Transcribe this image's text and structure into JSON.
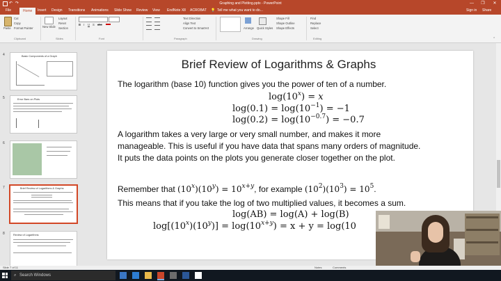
{
  "window": {
    "title": "Graphing and Plotting.pptx - PowerPoint",
    "controls": [
      "—",
      "❐",
      "✕"
    ]
  },
  "ribbon": {
    "tabs": [
      "File",
      "Home",
      "Insert",
      "Design",
      "Transitions",
      "Animations",
      "Slide Show",
      "Review",
      "View",
      "EndNote X8",
      "ACROBAT"
    ],
    "active_tab": "Home",
    "tell_me": "Tell me what you want to do...",
    "sign_in": "Sign in",
    "share": "Share",
    "clipboard": {
      "paste": "Paste",
      "cut": "Cut",
      "copy": "Copy",
      "format_painter": "Format Painter",
      "label": "Clipboard"
    },
    "slides": {
      "new_slide": "New Slide",
      "layout": "Layout",
      "reset": "Reset",
      "section": "Section",
      "label": "Slides"
    },
    "font": {
      "label": "Font"
    },
    "paragraph": {
      "text_direction": "Text Direction",
      "align_text": "Align Text",
      "convert_smartart": "Convert to SmartArt",
      "label": "Paragraph"
    },
    "drawing": {
      "arrange": "Arrange",
      "quick_styles": "Quick Styles",
      "shape_fill": "Shape Fill",
      "shape_outline": "Shape Outline",
      "shape_effects": "Shape Effects",
      "label": "Drawing"
    },
    "editing": {
      "find": "Find",
      "replace": "Replace",
      "select": "Select",
      "label": "Editing"
    }
  },
  "thumbnails": [
    {
      "num": "4",
      "title": "Basic Components of a Graph",
      "active": false
    },
    {
      "num": "5",
      "title": "Error Bars on Plots",
      "active": false
    },
    {
      "num": "6",
      "title": "",
      "active": false
    },
    {
      "num": "7",
      "title": "Brief Review of Logarithms & Graphs",
      "active": true
    },
    {
      "num": "8",
      "title": "Review of Logarithms",
      "active": false
    }
  ],
  "slide": {
    "title": "Brief Review of Logarithms & Graphs",
    "line1": "The logarithm (base 10) function gives you the power of ten of a number.",
    "eq1_left": "log(10",
    "eq1_sup": "x",
    "eq1_right": ") = ",
    "eq1_var": "x",
    "eq2": "log(0.1) = log(10",
    "eq2_sup": "−1",
    "eq2_right": ") = −1",
    "eq3": "log(0.2) = log(10",
    "eq3_sup": "−0.7",
    "eq3_right": ") = −0.7",
    "para1_line1": "A logarithm takes a very large or very small number, and makes it more",
    "para1_line2": "manageable. This is useful if you have data that spans many orders of magnitude.",
    "para1_line3": "It puts the data points on the plots you generate closer together on the plot.",
    "remember_a": "Remember that ",
    "remember_math1": "(10",
    "remember_sup1": "x",
    "remember_math2": ")(10",
    "remember_sup2": "y",
    "remember_math3": ") = 10",
    "remember_sup3": "x+y",
    "remember_b": ", for example ",
    "ex1": "(10",
    "ex_sup1": "2",
    "ex2": ")(10",
    "ex_sup2": "3",
    "ex3": ") = 10",
    "ex_sup3": "5",
    "ex4": ".",
    "line_sum": "This means that if you take the log of two multiplied values, it becomes a sum.",
    "eq4": "log(AB) = log(A) + log(B)",
    "eq5a": "log[(10",
    "eq5_sup1": "x",
    "eq5b": ")(10",
    "eq5_sup2": "y",
    "eq5c": ")] = log(10",
    "eq5_sup3": "x+y",
    "eq5d": ") = x + y = log(10"
  },
  "status": {
    "slide_of": "Slide 7 of 11",
    "notes": "Notes",
    "comments": "Comments"
  },
  "taskbar": {
    "search_placeholder": "Search Windows"
  },
  "colors": {
    "accent": "#b7472a",
    "active_thumb": "#d24726",
    "taskbar": "#111820"
  }
}
